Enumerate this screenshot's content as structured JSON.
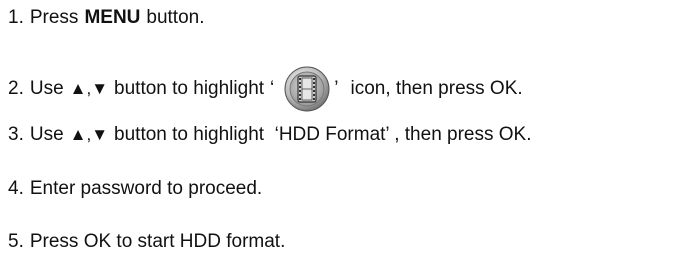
{
  "steps": [
    {
      "number": "1.",
      "pre": "Press",
      "bold": "MENU",
      "post": "button."
    },
    {
      "number": "2.",
      "pre": "Use",
      "arrows": "▲,▼",
      "mid": "button to highlight",
      "open_quote": "‘",
      "icon": "film-menu-icon",
      "close_quote": "’",
      "post": "icon, then press OK."
    },
    {
      "number": "3.",
      "pre": "Use",
      "arrows": "▲,▼",
      "post": "button to highlight  ‘HDD Format’ , then press OK."
    },
    {
      "number": "4.",
      "text": "Enter password to proceed."
    },
    {
      "number": "5.",
      "text": "Press OK to start HDD format."
    }
  ]
}
